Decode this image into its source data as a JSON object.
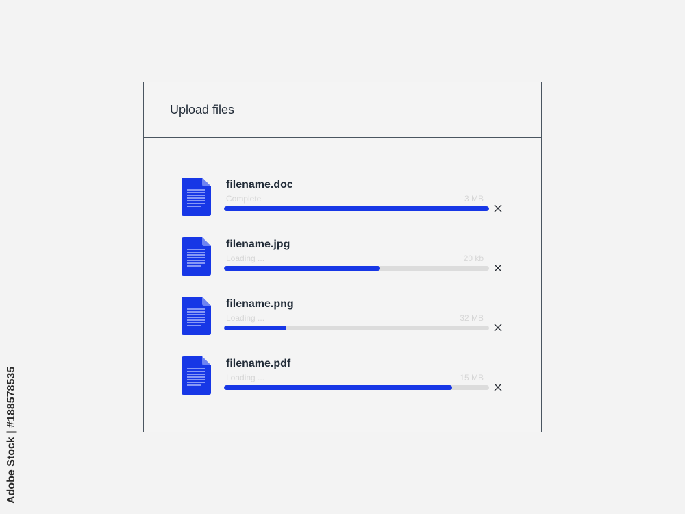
{
  "dialog": {
    "title": "Upload files",
    "files": [
      {
        "name": "filename.doc",
        "status": "Complete",
        "size": "3 MB",
        "progress": 1.0,
        "icon": "document-icon"
      },
      {
        "name": "filename.jpg",
        "status": "Loading ...",
        "size": "20 kb",
        "progress": 0.59,
        "icon": "document-icon"
      },
      {
        "name": "filename.png",
        "status": "Loading ...",
        "size": "32 MB",
        "progress": 0.235,
        "icon": "document-icon"
      },
      {
        "name": "filename.pdf",
        "status": "Loading ...",
        "size": "15 MB",
        "progress": 0.86,
        "icon": "document-icon"
      }
    ],
    "remove_icon": "close-icon"
  },
  "colors": {
    "accent": "#1737e6",
    "track": "#dcdcdc",
    "text": "#222c38",
    "muted": "#d6d6d6"
  },
  "watermark": {
    "text": "Adobe Stock | #188578535"
  }
}
